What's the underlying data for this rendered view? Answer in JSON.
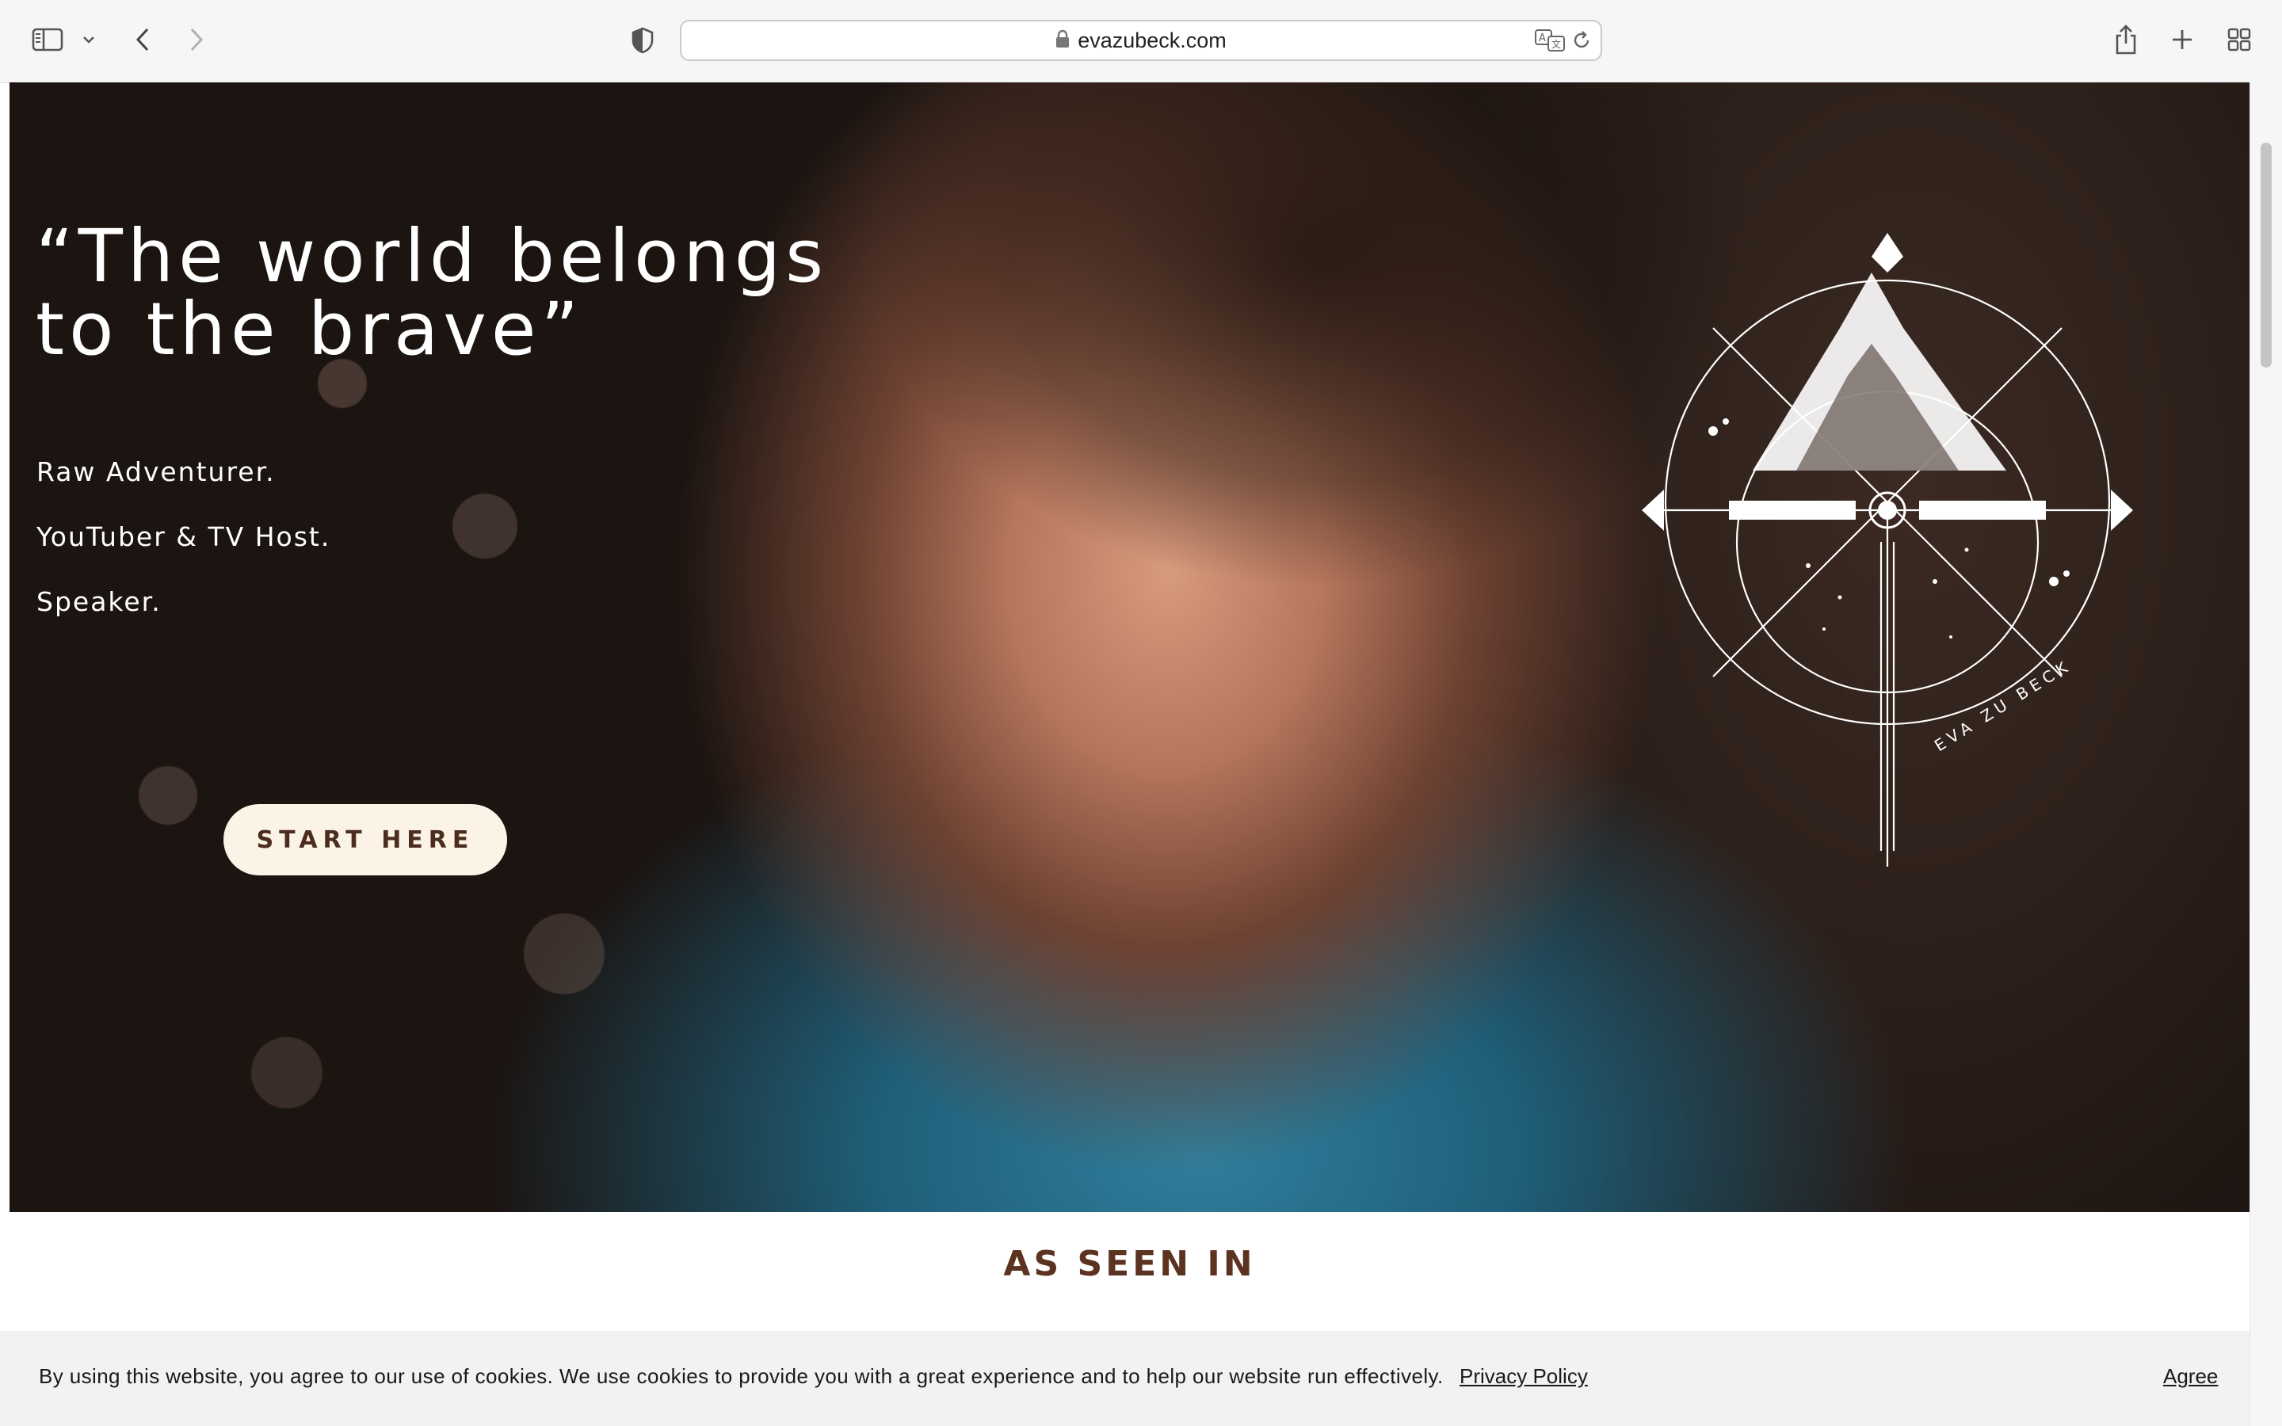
{
  "browser": {
    "url": "evazubeck.com",
    "icons": [
      "sidebar-icon",
      "chevron-down-icon",
      "back-icon",
      "forward-icon",
      "shield-icon",
      "lock-icon",
      "translate-icon",
      "reload-icon",
      "share-icon",
      "new-tab-icon",
      "tab-overview-icon"
    ]
  },
  "hero": {
    "quote": "“The world belongs to the brave”",
    "lines": [
      "Raw Adventurer.",
      "YouTuber & TV Host.",
      "Speaker."
    ],
    "cta_label": "START HERE",
    "emblem_text": "EVA ZU BECK"
  },
  "seen_in": {
    "title": "AS SEEN IN"
  },
  "cookie": {
    "message": "By using this website, you agree to our use of cookies. We use cookies to provide you with a great experience and to help our website run effectively.",
    "policy_link": "Privacy Policy",
    "agree_label": "Agree"
  },
  "colors": {
    "cta_background": "#fbf3e6",
    "cta_text": "#4a2d1f",
    "section_title": "#5b3320"
  }
}
